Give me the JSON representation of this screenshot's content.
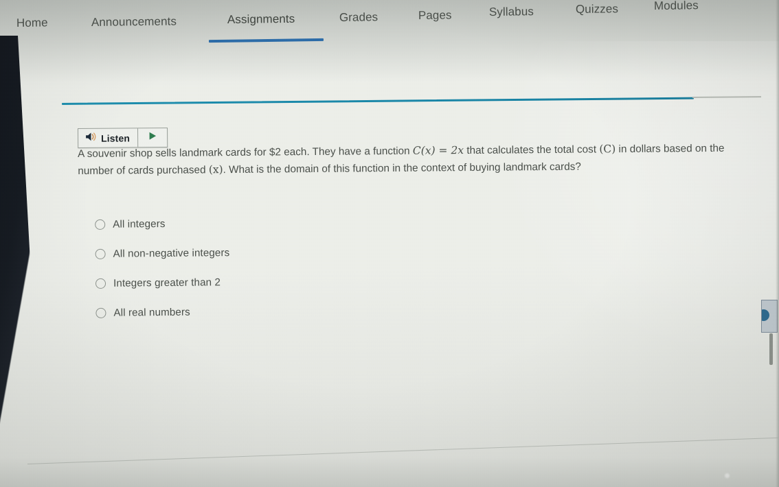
{
  "nav": {
    "tabs": [
      {
        "label": "Home",
        "active": false
      },
      {
        "label": "Announcements",
        "active": false
      },
      {
        "label": "Assignments",
        "active": true
      },
      {
        "label": "Grades",
        "active": false
      },
      {
        "label": "Pages",
        "active": false
      },
      {
        "label": "Syllabus",
        "active": false
      },
      {
        "label": "Quizzes",
        "active": false
      },
      {
        "label": "Modules",
        "active": false
      }
    ],
    "active_underline_color": "#2d6ca8"
  },
  "toolbar": {
    "listen_label": "Listen",
    "speaker_icon": "speaker-sound-icon",
    "play_icon": "play-triangle-icon",
    "play_icon_color": "#2e7d4f"
  },
  "divider": {
    "color": "#1a87a8",
    "trailing_color": "#b9bdb7"
  },
  "question": {
    "segment_1": "A souvenir shop sells landmark cards for $2 each. They have a function ",
    "math_function": "C(x) = 2x",
    "segment_2": " that calculates the total cost ",
    "math_cost": "(C)",
    "segment_3": " in dollars based on the number of cards purchased ",
    "math_variable": "(x)",
    "segment_4": ". What is the domain of this function in the context of buying landmark cards?"
  },
  "options": [
    {
      "label": "All integers",
      "selected": false
    },
    {
      "label": "All non-negative integers",
      "selected": false
    },
    {
      "label": "Integers greater than 2",
      "selected": false
    },
    {
      "label": "All real numbers",
      "selected": false
    }
  ],
  "colors": {
    "page_background": "#e9ebe6",
    "text": "#4b504b",
    "accent_blue": "#2d6ca8",
    "accent_teal": "#1a87a8"
  }
}
